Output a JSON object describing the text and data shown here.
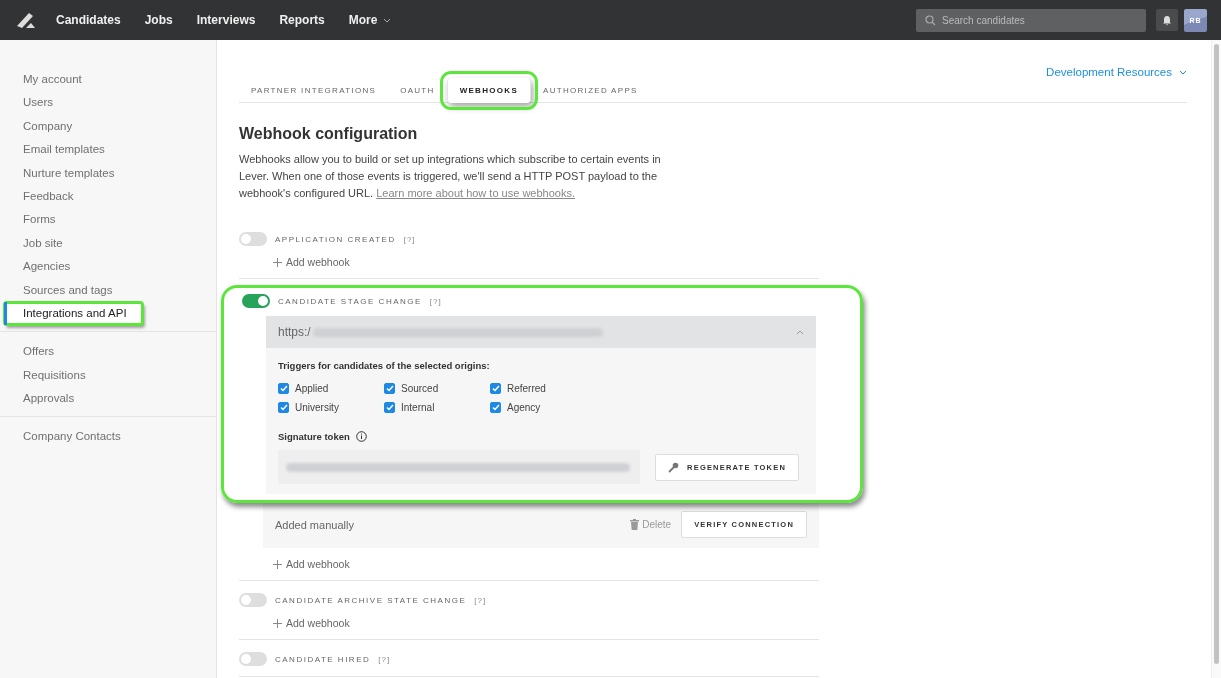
{
  "nav": {
    "items": [
      {
        "label": "Candidates"
      },
      {
        "label": "Jobs"
      },
      {
        "label": "Interviews"
      },
      {
        "label": "Reports"
      }
    ],
    "more": "More"
  },
  "search": {
    "placeholder": "Search candidates"
  },
  "avatar": {
    "initials": "RB"
  },
  "sidebar": {
    "groups": [
      [
        {
          "label": "My account",
          "selected": false,
          "highlighted": false
        },
        {
          "label": "Users",
          "selected": false,
          "highlighted": false
        },
        {
          "label": "Company",
          "selected": false,
          "highlighted": false
        },
        {
          "label": "Email templates",
          "selected": false,
          "highlighted": false
        },
        {
          "label": "Nurture templates",
          "selected": false,
          "highlighted": false
        },
        {
          "label": "Feedback",
          "selected": false,
          "highlighted": false
        },
        {
          "label": "Forms",
          "selected": false,
          "highlighted": false
        },
        {
          "label": "Job site",
          "selected": false,
          "highlighted": false
        },
        {
          "label": "Agencies",
          "selected": false,
          "highlighted": false
        },
        {
          "label": "Sources and tags",
          "selected": false,
          "highlighted": false
        },
        {
          "label": "Integrations and API",
          "selected": true,
          "highlighted": true
        }
      ],
      [
        {
          "label": "Offers",
          "selected": false,
          "highlighted": false
        },
        {
          "label": "Requisitions",
          "selected": false,
          "highlighted": false
        },
        {
          "label": "Approvals",
          "selected": false,
          "highlighted": false
        }
      ],
      [
        {
          "label": "Company Contacts",
          "selected": false,
          "highlighted": false
        }
      ]
    ]
  },
  "tabs": [
    {
      "label": "PARTNER INTEGRATIONS",
      "selected": false,
      "highlighted": false
    },
    {
      "label": "OAUTH",
      "selected": false,
      "highlighted": false
    },
    {
      "label": "WEBHOOKS",
      "selected": true,
      "highlighted": true
    },
    {
      "label": "AUTHORIZED APPS",
      "selected": false,
      "highlighted": false
    }
  ],
  "dev_resources": "Development Resources",
  "heading": "Webhook configuration",
  "description": "Webhooks allow you to build or set up integrations which subscribe to certain events in Lever. When one of those events is triggered, we'll send a HTTP POST payload to the webhook's configured URL.",
  "learn_more_link": "Learn more about how to use webhooks.",
  "webhooks": [
    {
      "name": "APPLICATION CREATED",
      "help": "[?]",
      "on": false,
      "highlighted": false,
      "add_label": "Add webhook"
    },
    {
      "name": "CANDIDATE STAGE CHANGE",
      "help": "[?]",
      "on": true,
      "highlighted": true,
      "add_label": "Add webhook",
      "config": {
        "url_prefix": "https:/",
        "expanded": true,
        "triggers_title": "Triggers for candidates of the selected origins:",
        "origins": [
          {
            "label": "Applied",
            "checked": true
          },
          {
            "label": "Sourced",
            "checked": true
          },
          {
            "label": "Referred",
            "checked": true
          },
          {
            "label": "University",
            "checked": true
          },
          {
            "label": "Internal",
            "checked": true
          },
          {
            "label": "Agency",
            "checked": true
          }
        ],
        "token_label": "Signature token",
        "regenerate": "REGENERATE TOKEN",
        "source": "Added manually",
        "delete": "Delete",
        "verify": "VERIFY CONNECTION"
      }
    },
    {
      "name": "CANDIDATE ARCHIVE STATE CHANGE",
      "help": "[?]",
      "on": false,
      "highlighted": false,
      "add_label": "Add webhook"
    },
    {
      "name": "CANDIDATE HIRED",
      "help": "[?]",
      "on": false,
      "highlighted": false
    }
  ]
}
